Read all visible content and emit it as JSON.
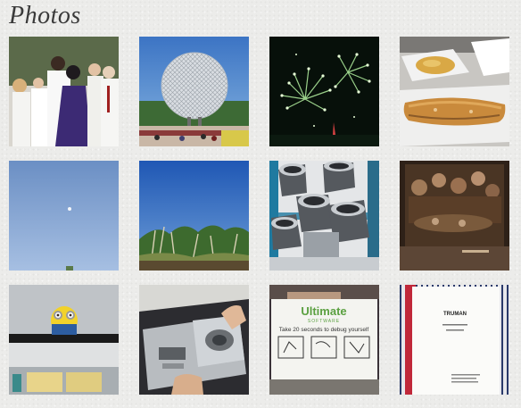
{
  "header": {
    "title": "Photos"
  },
  "sign": {
    "brand": "Ultimate",
    "brand_sub": "SOFTWARE",
    "message": "Take 20 seconds to debug yourself"
  },
  "script_page": {
    "title": "TRUMAN"
  }
}
